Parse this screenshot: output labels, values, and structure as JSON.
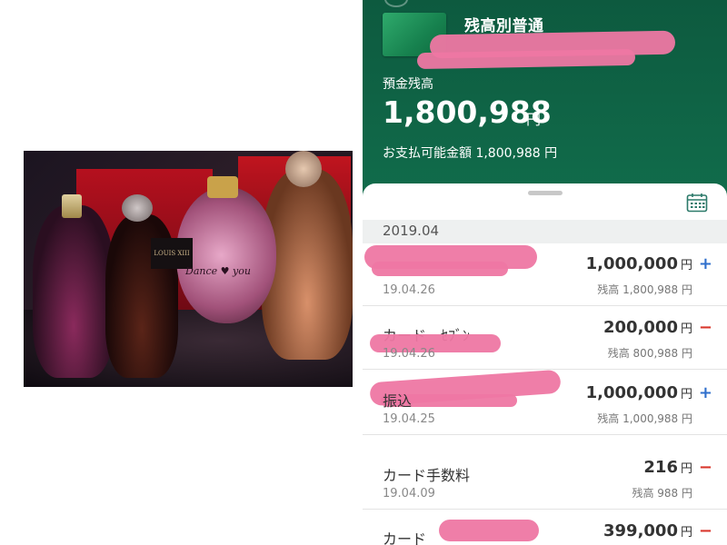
{
  "left_photo": {
    "label_text": "LOUIS XIII",
    "script_text": "Dance ♥ you"
  },
  "account": {
    "title": "残高別普通",
    "balance_label": "預金残高",
    "balance_amount": "1,800,988",
    "balance_unit": "円",
    "available_text": "お支払可能金額 1,800,988 円"
  },
  "month_header": "2019.04",
  "calendar_icon": "calendar-icon",
  "colors": {
    "header_green": "#0d5a3f",
    "plus_blue": "#2f6fcc",
    "minus_red": "#d9362b",
    "redaction_pink": "#ee77a3"
  },
  "transactions": [
    {
      "description": "",
      "date": "19.04.26",
      "amount": "1,000,000",
      "yen": "円",
      "sign": "+",
      "balance": "残高 1,800,988 円"
    },
    {
      "description": "カード　ｾﾌﾞﾝ",
      "date": "19.04.26",
      "amount": "200,000",
      "yen": "円",
      "sign": "−",
      "balance": "残高 800,988 円"
    },
    {
      "description": "振込",
      "date": "19.04.25",
      "amount": "1,000,000",
      "yen": "円",
      "sign": "+",
      "balance": "残高 1,000,988 円"
    },
    {
      "description": "カード手数料",
      "date": "19.04.09",
      "amount": "216",
      "yen": "円",
      "sign": "−",
      "balance": "残高 988 円"
    },
    {
      "description": "カード",
      "date": "",
      "amount": "399,000",
      "yen": "円",
      "sign": "−",
      "balance": ""
    }
  ]
}
